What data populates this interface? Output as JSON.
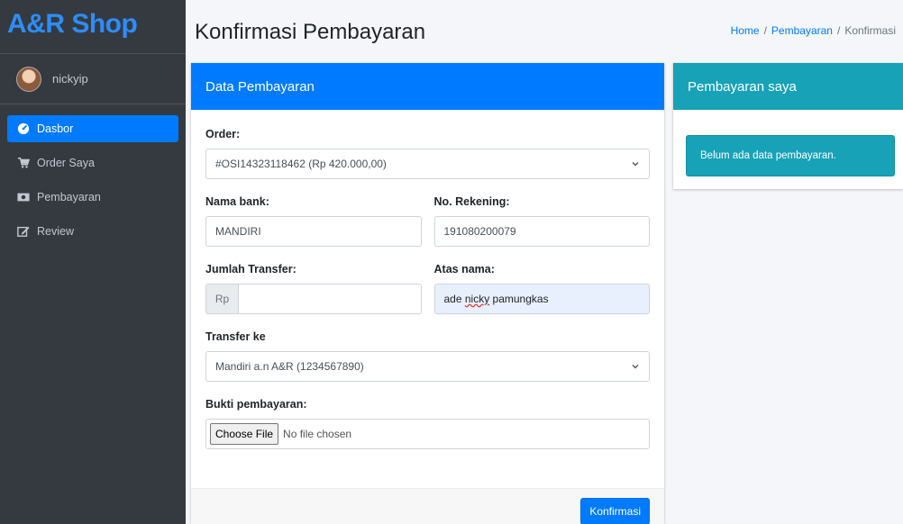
{
  "brand": {
    "name": "A&R Shop",
    "color": "#2e8cf7"
  },
  "user": {
    "name": "nickyip"
  },
  "sidebar": {
    "items": [
      {
        "label": "Dasbor",
        "icon": "dashboard-icon",
        "active": true
      },
      {
        "label": "Order Saya",
        "icon": "cart-icon",
        "active": false
      },
      {
        "label": "Pembayaran",
        "icon": "money-icon",
        "active": false
      },
      {
        "label": "Review",
        "icon": "edit-icon",
        "active": false
      }
    ]
  },
  "header": {
    "title": "Konfirmasi Pembayaran",
    "breadcrumb": [
      "Home",
      "Pembayaran",
      "Konfirmasi"
    ]
  },
  "form": {
    "title": "Data Pembayaran",
    "order": {
      "label": "Order:",
      "value": "#OSI14323118462 (Rp 420.000,00)"
    },
    "bank": {
      "label": "Nama bank:",
      "value": "MANDIRI"
    },
    "rekening": {
      "label": "No. Rekening:",
      "value": "191080200079"
    },
    "jumlah": {
      "label": "Jumlah Transfer:",
      "prefix": "Rp",
      "value": ""
    },
    "atas_nama": {
      "label": "Atas nama:",
      "value_part1": "ade ",
      "value_underlined": "nicky",
      "value_part2": " pamungkas"
    },
    "transfer_ke": {
      "label": "Transfer ke",
      "value": "Mandiri a.n A&R (1234567890)"
    },
    "bukti": {
      "label": "Bukti pembayaran:",
      "button": "Choose File",
      "status": "No file chosen"
    },
    "submit_label": "Konfirmasi"
  },
  "side": {
    "title": "Pembayaran saya",
    "empty_message": "Belum ada data pembayaran."
  },
  "colors": {
    "primary": "#007bff",
    "info": "#17a2b8",
    "sidebar": "#343a40"
  }
}
